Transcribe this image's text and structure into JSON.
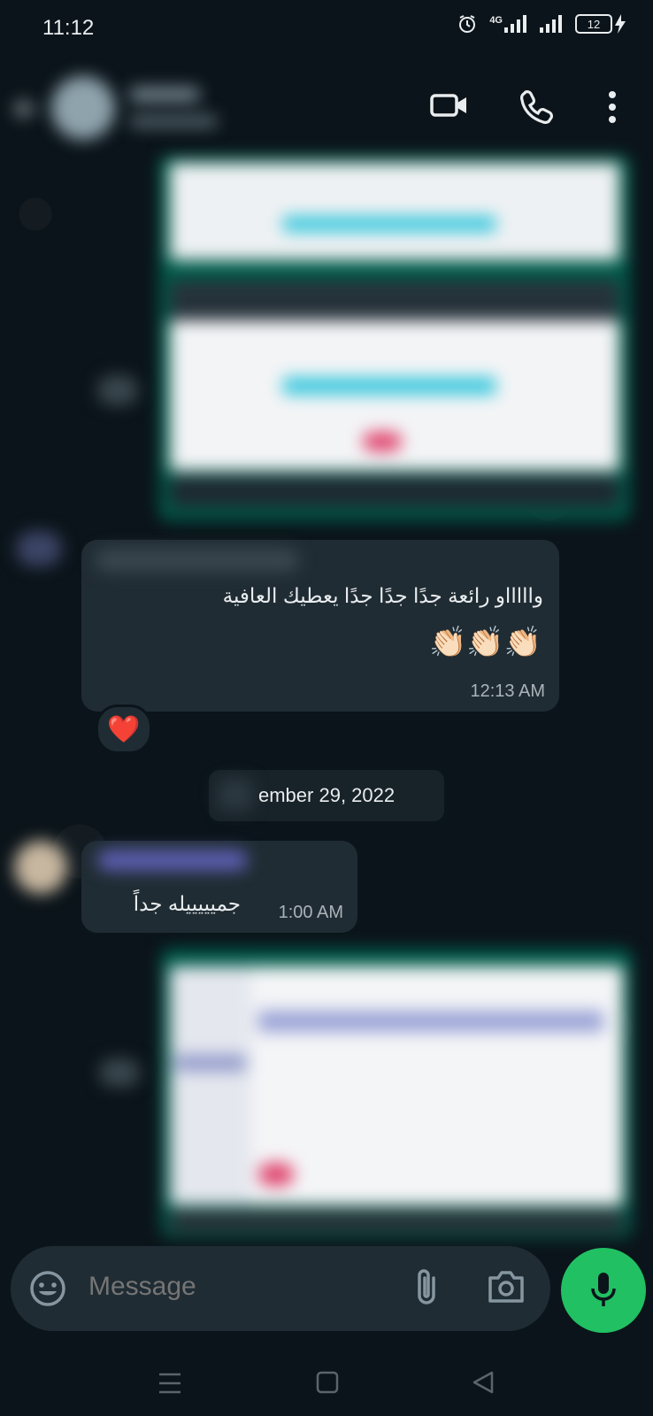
{
  "status_bar": {
    "time": "11:12",
    "network": "4G",
    "battery": "12"
  },
  "messages": [
    {
      "type": "text",
      "text": "واااااو رائعة جدًا جدًا جدًا يعطيك العافية",
      "emoji": "👏🏻👏🏻👏🏻",
      "time": "12:13 AM",
      "reaction": "❤️"
    },
    {
      "type": "date",
      "text": "ember 29, 2022"
    },
    {
      "type": "text",
      "text": "جميييييله جداً",
      "time": "1:00 AM"
    }
  ],
  "composer": {
    "placeholder": "Message"
  },
  "colors": {
    "background": "#0b141a",
    "bubble_in": "#202c33",
    "outgoing_image_bubble": "#005c4b",
    "mic_button": "#21c063"
  }
}
